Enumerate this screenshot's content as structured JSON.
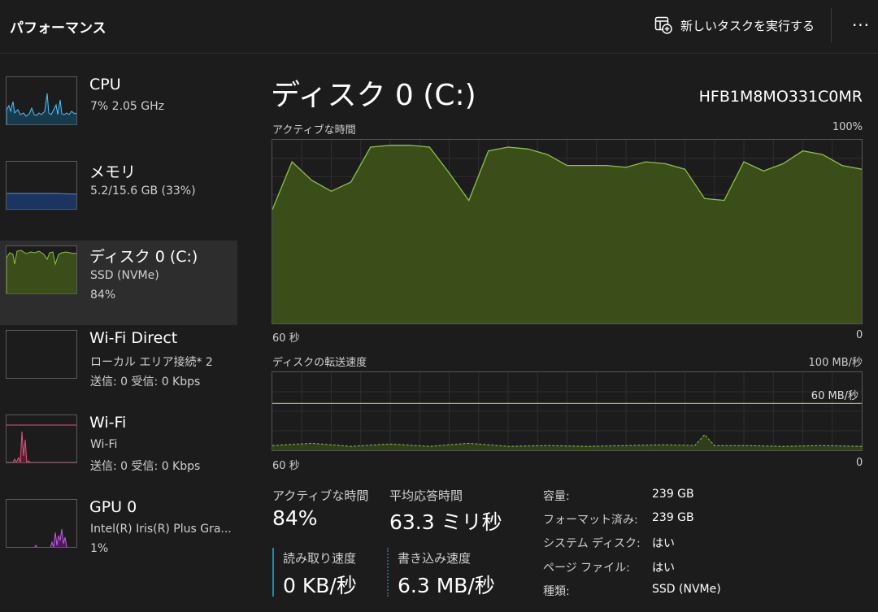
{
  "header": {
    "title": "パフォーマンス",
    "run_task_label": "新しいタスクを実行する",
    "more_label": "···"
  },
  "sidebar": {
    "items": [
      {
        "name": "CPU",
        "sub1": "7%  2.05 GHz",
        "sub2": "",
        "color": "#4cc2ff"
      },
      {
        "name": "メモリ",
        "sub1": "5.2/15.6 GB (33%)",
        "sub2": "",
        "color": "#3d7bd9"
      },
      {
        "name": "ディスク 0 (C:)",
        "sub1": "SSD (NVMe)",
        "sub2": "84%",
        "color": "#8ac43f"
      },
      {
        "name": "Wi-Fi Direct",
        "sub1": "ローカル エリア接続* 2",
        "sub2": "送信: 0  受信: 0 Kbps",
        "color": "#ff7fa0"
      },
      {
        "name": "Wi-Fi",
        "sub1": "Wi-Fi",
        "sub2": "送信: 0  受信: 0 Kbps",
        "color": "#e0557e"
      },
      {
        "name": "GPU 0",
        "sub1": "Intel(R) Iris(R) Plus Gra...",
        "sub2": "1%",
        "color": "#c25ae0"
      }
    ],
    "selected_index": 2
  },
  "main": {
    "title": "ディスク 0 (C:)",
    "model": "HFB1M8MO331C0MR",
    "chart1": {
      "label": "アクティブな時間",
      "max_label": "100%",
      "x_left": "60 秒",
      "x_right": "0"
    },
    "chart2": {
      "label": "ディスクの転送速度",
      "max_label": "100 MB/秒",
      "line_label": "60 MB/秒",
      "x_left": "60 秒",
      "x_right": "0"
    },
    "stats": {
      "active_time_label": "アクティブな時間",
      "active_time_value": "84%",
      "avg_response_label": "平均応答時間",
      "avg_response_value": "63.3 ミリ秒",
      "read_speed_label": "読み取り速度",
      "read_speed_value": "0 KB/秒",
      "write_speed_label": "書き込み速度",
      "write_speed_value": "6.3 MB/秒"
    },
    "properties": [
      {
        "label": "容量:",
        "value": "239 GB"
      },
      {
        "label": "フォーマット済み:",
        "value": "239 GB"
      },
      {
        "label": "システム ディスク:",
        "value": "はい"
      },
      {
        "label": "ページ ファイル:",
        "value": "はい"
      },
      {
        "label": "種類:",
        "value": "SSD (NVMe)"
      }
    ]
  },
  "colors": {
    "disk_line": "#8ac43f",
    "disk_fill": "#3b4d19",
    "read_accent": "#1f8ab8",
    "write_accent": "#2b5f7a"
  },
  "chart_data": [
    {
      "type": "area",
      "title": "アクティブな時間",
      "ylim": [
        0,
        100
      ],
      "x": [
        60,
        58,
        56,
        54,
        52,
        50,
        48,
        46,
        44,
        42,
        40,
        38,
        36,
        34,
        32,
        30,
        28,
        26,
        24,
        22,
        20,
        18,
        16,
        14,
        12,
        10,
        8,
        6,
        4,
        2,
        0
      ],
      "values": [
        62,
        88,
        78,
        72,
        77,
        96,
        97,
        97,
        96,
        82,
        67,
        94,
        96,
        95,
        92,
        86,
        86,
        86,
        85,
        88,
        87,
        84,
        68,
        67,
        88,
        83,
        87,
        94,
        92,
        86,
        84
      ]
    },
    {
      "type": "line",
      "title": "ディスクの転送速度",
      "ylim": [
        0,
        100
      ],
      "x": [
        60,
        56,
        52,
        48,
        44,
        40,
        36,
        32,
        28,
        24,
        20,
        17,
        16,
        15,
        12,
        8,
        4,
        0
      ],
      "values": [
        6,
        9,
        5,
        8,
        5,
        9,
        5,
        6,
        5,
        6,
        7,
        6,
        20,
        6,
        6,
        5,
        6,
        5
      ],
      "reference_line": 60
    }
  ]
}
